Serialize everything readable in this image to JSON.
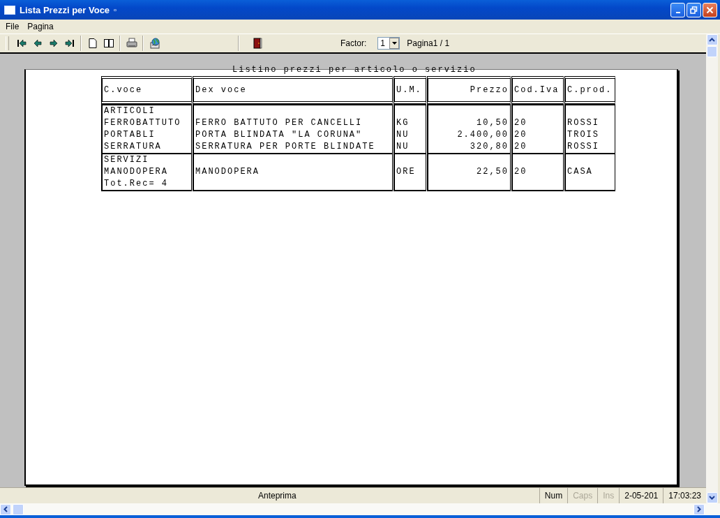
{
  "window": {
    "title": "Lista Prezzi per Voce",
    "title_mark": "▫"
  },
  "menu": [
    {
      "label": "File"
    },
    {
      "label": "Pagina"
    }
  ],
  "toolbar": {
    "factor_label": "Factor:",
    "factor_value": "1",
    "page_info": "Pagina1 / 1"
  },
  "report": {
    "title": "Listino prezzi per articolo o servizio",
    "columns": [
      {
        "label": "C.voce",
        "kind": "text"
      },
      {
        "label": "Dex voce",
        "kind": "text"
      },
      {
        "label": "U.M.",
        "kind": "text"
      },
      {
        "label": "Prezzo",
        "kind": "number"
      },
      {
        "label": "Cod.Iva",
        "kind": "text"
      },
      {
        "label": "C.prod.",
        "kind": "text"
      }
    ],
    "groups": [
      {
        "rows": [
          {
            "cells": [
              "ARTICOLI"
            ]
          },
          {
            "cells": [
              "FERROBATTUTO",
              "FERRO BATTUTO PER CANCELLI",
              "KG",
              "10,50",
              "20",
              "ROSSI"
            ]
          },
          {
            "cells": [
              "PORTABLI",
              "PORTA BLINDATA \"LA CORUNA\"",
              "NU",
              "2.400,00",
              "20",
              "TROIS"
            ]
          },
          {
            "cells": [
              "SERRATURA",
              "SERRATURA PER PORTE BLINDATE",
              "NU",
              "320,80",
              "20",
              "ROSSI"
            ]
          }
        ]
      },
      {
        "rows": [
          {
            "cells": [
              "SERVIZI"
            ]
          },
          {
            "cells": [
              "MANODOPERA",
              "MANODOPERA",
              "ORE",
              "22,50",
              "20",
              "CASA"
            ]
          },
          {
            "cells": [
              "Tot.Rec= 4"
            ]
          }
        ]
      }
    ]
  },
  "status_bar": {
    "message": "Anteprima",
    "indicators": [
      {
        "label": "Num",
        "on": true
      },
      {
        "label": "Caps",
        "on": false
      },
      {
        "label": "Ins",
        "on": false
      }
    ],
    "date": "2-05-201",
    "time": "17:03:23"
  }
}
